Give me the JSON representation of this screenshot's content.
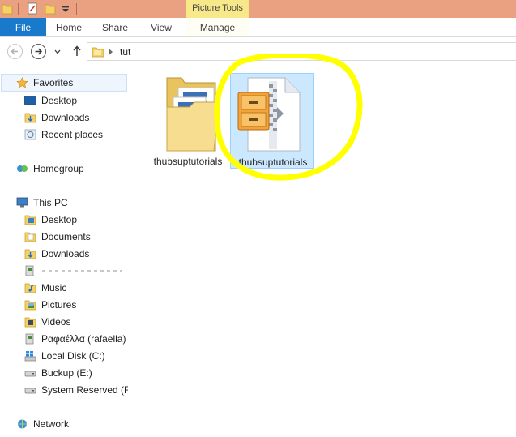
{
  "ribbon": {
    "contextual_group": "Picture Tools",
    "tabs": [
      {
        "label": "File"
      },
      {
        "label": "Home"
      },
      {
        "label": "Share"
      },
      {
        "label": "View"
      },
      {
        "label": "Manage"
      }
    ]
  },
  "address": {
    "path": "tut"
  },
  "nav": {
    "favorites": {
      "label": "Favorites",
      "items": [
        "Desktop",
        "Downloads",
        "Recent places"
      ]
    },
    "homegroup": "Homegroup",
    "this_pc": {
      "label": "This PC",
      "items": [
        "Desktop",
        "Documents",
        "Downloads",
        "",
        "Music",
        "Pictures",
        "Videos",
        "Ραφαέλλα (rafaella)",
        "Local Disk (C:)",
        "Buckup (E:)",
        "System Reserved (F:)"
      ]
    },
    "network": "Network"
  },
  "files": [
    {
      "name": "thubsuptutorials",
      "type": "folder",
      "icon": "folder-icon",
      "selected": false
    },
    {
      "name": "thubsuptutorials",
      "type": "zip",
      "icon": "zip-archive-icon",
      "selected": true
    }
  ],
  "colors": {
    "title_bar": "#e9a182",
    "picture_tools": "#f7e989",
    "file_tab": "#1979ca",
    "selection": "#cce8ff",
    "highlight_circle": "#ffff00"
  }
}
